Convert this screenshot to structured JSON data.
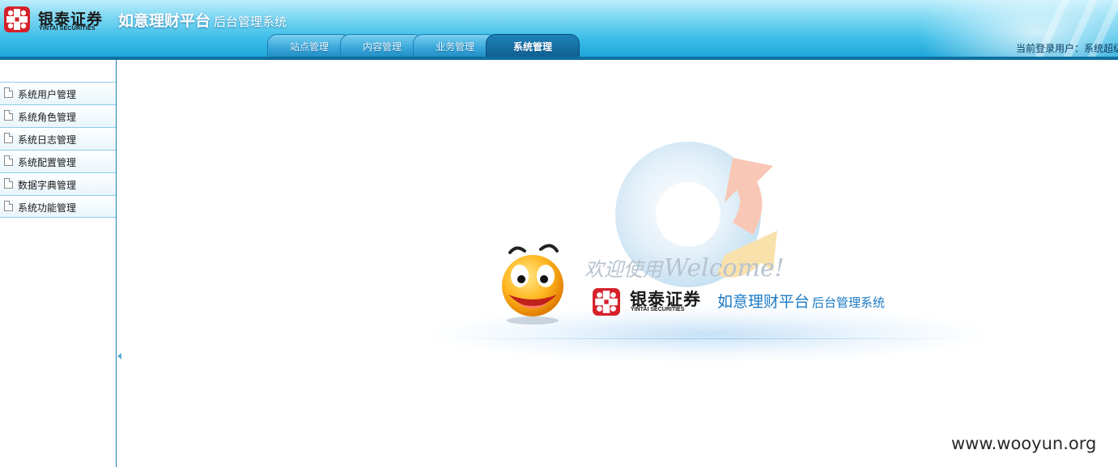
{
  "header": {
    "logo_cn": "银泰证券",
    "logo_en": "YINTAI SECURITIES",
    "title_main": "如意理财平台",
    "title_sub": "后台管理系统",
    "user_info": "当前登录用户：系统超级"
  },
  "tabs": [
    {
      "label": "站点管理",
      "active": false
    },
    {
      "label": "内容管理",
      "active": false
    },
    {
      "label": "业务管理",
      "active": false
    },
    {
      "label": "系统管理",
      "active": true
    }
  ],
  "sidebar": {
    "items": [
      {
        "label": "系统用户管理",
        "icon": "document-icon"
      },
      {
        "label": "系统角色管理",
        "icon": "document-icon"
      },
      {
        "label": "系统日志管理",
        "icon": "document-icon"
      },
      {
        "label": "系统配置管理",
        "icon": "document-icon"
      },
      {
        "label": "数据字典管理",
        "icon": "document-icon"
      },
      {
        "label": "系统功能管理",
        "icon": "document-icon"
      }
    ]
  },
  "welcome": {
    "greeting_cn": "欢迎使用",
    "greeting_en": "Welcome!",
    "logo_cn": "银泰证券",
    "logo_en": "YINTAI SECURITIES",
    "title_main": "如意理财平台",
    "title_sub": "后台管理系统"
  },
  "watermark": "www.wooyun.org",
  "colors": {
    "header_top": "#bfeefc",
    "header_bottom": "#1aa3d8",
    "tab_active": "#0f5f92",
    "brand_red": "#d6202a",
    "welcome_blue": "#1b7ac4"
  }
}
